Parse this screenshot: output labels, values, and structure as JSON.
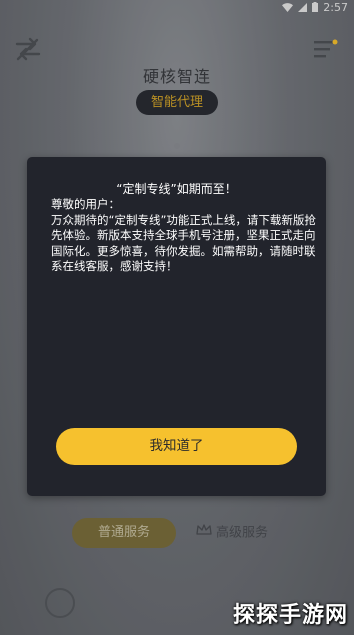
{
  "status_bar": {
    "time": "2:57",
    "icons": [
      "wifi-icon",
      "signal-icon",
      "battery-icon"
    ]
  },
  "header": {
    "title": "硬核智连",
    "mode_badge": "智能代理",
    "left_icon": "swap-icon",
    "right_icon": "menu-icon"
  },
  "bottom_tabs": {
    "normal": "普通服务",
    "premium": "高级服务",
    "premium_icon": "crown-icon"
  },
  "dialog": {
    "title": "“定制专线”如期而至！",
    "greeting": "尊敬的用户：",
    "body": "万众期待的“定制专线”功能正式上线，请下载新版抢先体验。新版本支持全球手机号注册，坚果正式走向国际化。更多惊喜，待你发掘。如需帮助，请随时联系在线客服，感谢支持！",
    "confirm_label": "我知道了"
  },
  "watermark": "探探手游网",
  "colors": {
    "accent": "#f6c12e",
    "dialog_bg": "#22242c",
    "badge_text": "#d4a52a"
  }
}
